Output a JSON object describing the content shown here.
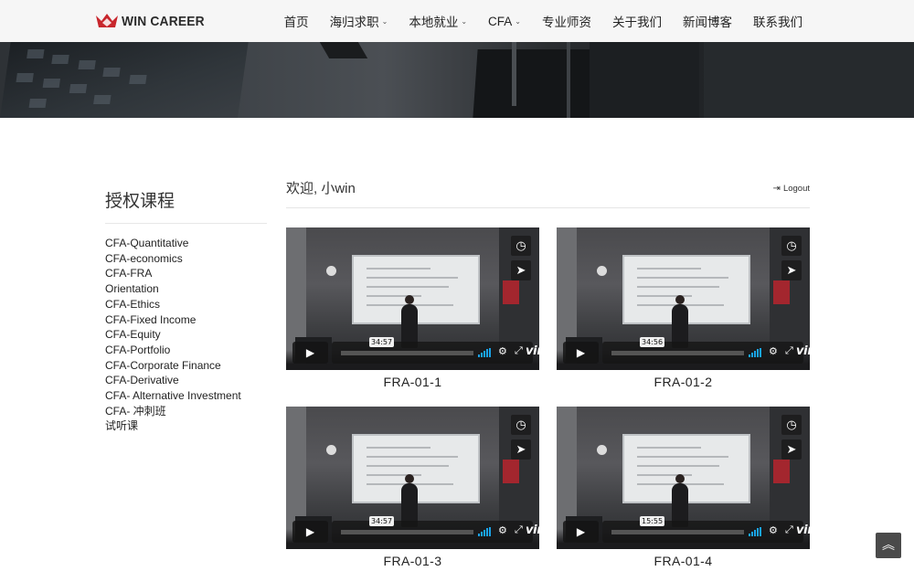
{
  "header": {
    "logo_text": "WIN CAREER",
    "nav": [
      {
        "label": "首页",
        "has_dropdown": false
      },
      {
        "label": "海归求职",
        "has_dropdown": true
      },
      {
        "label": "本地就业",
        "has_dropdown": true
      },
      {
        "label": "CFA",
        "has_dropdown": true
      },
      {
        "label": "专业师资",
        "has_dropdown": false
      },
      {
        "label": "关于我们",
        "has_dropdown": false
      },
      {
        "label": "新闻博客",
        "has_dropdown": false
      },
      {
        "label": "联系我们",
        "has_dropdown": false
      }
    ]
  },
  "sidebar": {
    "title": "授权课程",
    "courses": [
      "CFA-Quantitative",
      "CFA-economics",
      "CFA-FRA",
      "Orientation",
      "CFA-Ethics",
      "CFA-Fixed Income",
      "CFA-Equity",
      "CFA-Portfolio",
      "CFA-Corporate Finance",
      "CFA-Derivative",
      "CFA- Alternative Investment",
      "CFA- 冲刺班",
      "试听课"
    ]
  },
  "main": {
    "welcome": "欢迎, 小win",
    "logout_label": "Logout",
    "videos": [
      {
        "title": "FRA-01-1",
        "duration": "34:57",
        "brand": "vimeo"
      },
      {
        "title": "FRA-01-2",
        "duration": "34:56",
        "brand": "vimeo"
      },
      {
        "title": "FRA-01-3",
        "duration": "34:57",
        "brand": "vimeo"
      },
      {
        "title": "FRA-01-4",
        "duration": "15:55",
        "brand": "vimeo"
      }
    ]
  },
  "colors": {
    "logo_red": "#c8262c",
    "volume_blue": "#1aa3e8",
    "header_bg": "#f6f6f6"
  }
}
